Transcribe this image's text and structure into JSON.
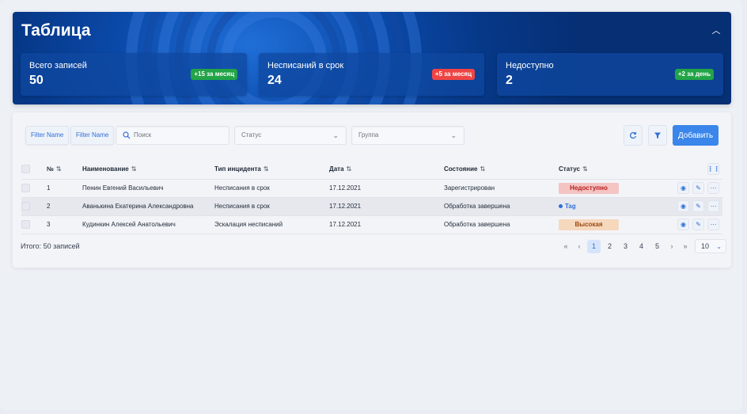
{
  "banner": {
    "title": "Таблица",
    "collapse_icon": "chevron-up-icon",
    "stats": [
      {
        "label": "Всего записей",
        "value": "50",
        "badge": "+15 за месяц",
        "badge_color": "#22a447"
      },
      {
        "label": "Несписаний в срок",
        "value": "24",
        "badge": "+5 за месяц",
        "badge_color": "#ef4444"
      },
      {
        "label": "Недоступно",
        "value": "2",
        "badge": "+2 за день",
        "badge_color": "#22a447"
      }
    ]
  },
  "toolbar": {
    "filter_chip_1": "Filter Name",
    "filter_chip_2": "Filter Name",
    "search_placeholder": "Поиск",
    "status_placeholder": "Статус",
    "group_placeholder": "Группа",
    "refresh_icon": "refresh-icon",
    "filter_icon": "filter-icon",
    "add_label": "Добавить"
  },
  "table": {
    "columns": {
      "num": "№",
      "name": "Наименование",
      "type": "Тип инцидента",
      "date": "Дата",
      "state": "Состояние",
      "status": "Статус"
    },
    "sort_icon": "⇅",
    "rows": [
      {
        "num": "1",
        "name": "Пенин Евгений Васильевич",
        "type": "Несписания в срок",
        "date": "17.12.2021",
        "state": "Зарегистрирован",
        "status": "Недоступно",
        "status_style": "pill-red"
      },
      {
        "num": "2",
        "name": "Аванькина Екатерина Александровна",
        "type": "Несписания в срок",
        "date": "17.12.2021",
        "state": "Обработка завершена",
        "status": "Tag",
        "status_style": "tag"
      },
      {
        "num": "3",
        "name": "Кудинкин Алексей Анатольевич",
        "type": "Эскалация несписаний",
        "date": "17.12.2021",
        "state": "Обработка завершена",
        "status": "Высокая",
        "status_style": "pill-orange"
      }
    ],
    "colors": {
      "pill_red_bg": "#f3c4c2",
      "pill_red_fg": "#b91c1c",
      "pill_orange_bg": "#f6d8bd",
      "pill_orange_fg": "#9a4a12",
      "tag": "#2f6fd6"
    }
  },
  "footer": {
    "total": "Итого: 50 записей",
    "pages": [
      "1",
      "2",
      "3",
      "4",
      "5"
    ],
    "current_page": "1",
    "page_size": "10"
  }
}
